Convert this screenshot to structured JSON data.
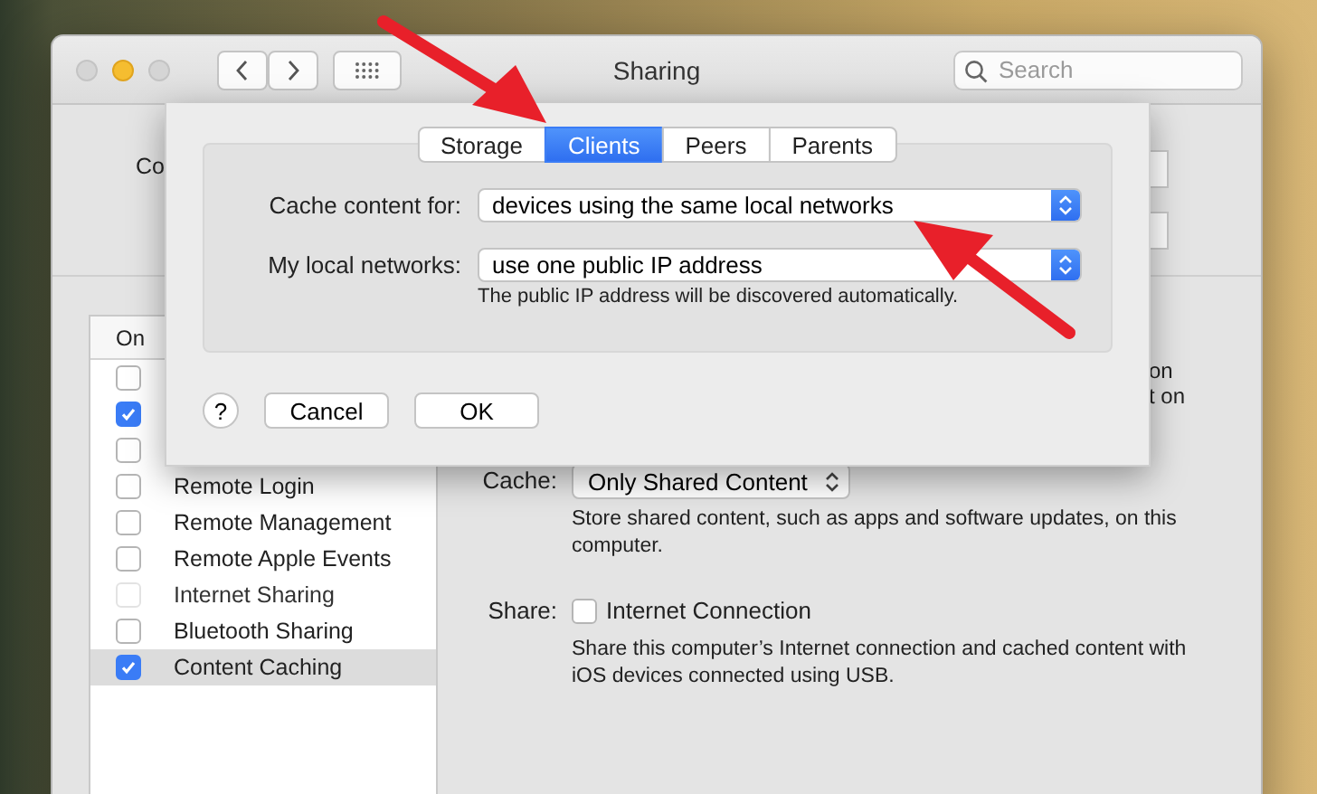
{
  "window": {
    "title": "Sharing",
    "search_placeholder": "Search"
  },
  "computer_name": {
    "label_partial": "Co"
  },
  "services": {
    "column_header": "On",
    "rows": [
      {
        "checked": false,
        "disabled": false,
        "selected": false
      },
      {
        "checked": true,
        "disabled": false,
        "selected": false
      },
      {
        "checked": false,
        "disabled": false,
        "selected": false
      },
      {
        "name": "Remote Login",
        "checked": false,
        "disabled": false,
        "selected": false
      },
      {
        "name": "Remote Management",
        "checked": false,
        "disabled": false,
        "selected": false
      },
      {
        "name": "Remote Apple Events",
        "checked": false,
        "disabled": false,
        "selected": false
      },
      {
        "name": "Internet Sharing",
        "checked": false,
        "disabled": true,
        "selected": false
      },
      {
        "name": "Bluetooth Sharing",
        "checked": false,
        "disabled": false,
        "selected": false
      },
      {
        "name": "Content Caching",
        "checked": true,
        "disabled": false,
        "selected": true
      }
    ]
  },
  "details": {
    "partial_lines": [
      "on",
      "t on"
    ],
    "cache": {
      "label": "Cache:",
      "value": "Only Shared Content",
      "description": "Store shared content, such as apps and software updates, on this computer."
    },
    "share": {
      "label": "Share:",
      "option": "Internet Connection",
      "checked": false,
      "description": "Share this computer’s Internet connection and cached content with iOS devices connected using USB."
    }
  },
  "sheet": {
    "tabs": [
      {
        "label": "Storage",
        "selected": false
      },
      {
        "label": "Clients",
        "selected": true
      },
      {
        "label": "Peers",
        "selected": false
      },
      {
        "label": "Parents",
        "selected": false
      }
    ],
    "fields": [
      {
        "label": "Cache content for:",
        "value": "devices using the same local networks"
      },
      {
        "label": "My local networks:",
        "value": "use one public IP address",
        "note": "The public IP address will be discovered automatically."
      }
    ],
    "help": "?",
    "buttons": [
      "Cancel",
      "OK"
    ]
  }
}
